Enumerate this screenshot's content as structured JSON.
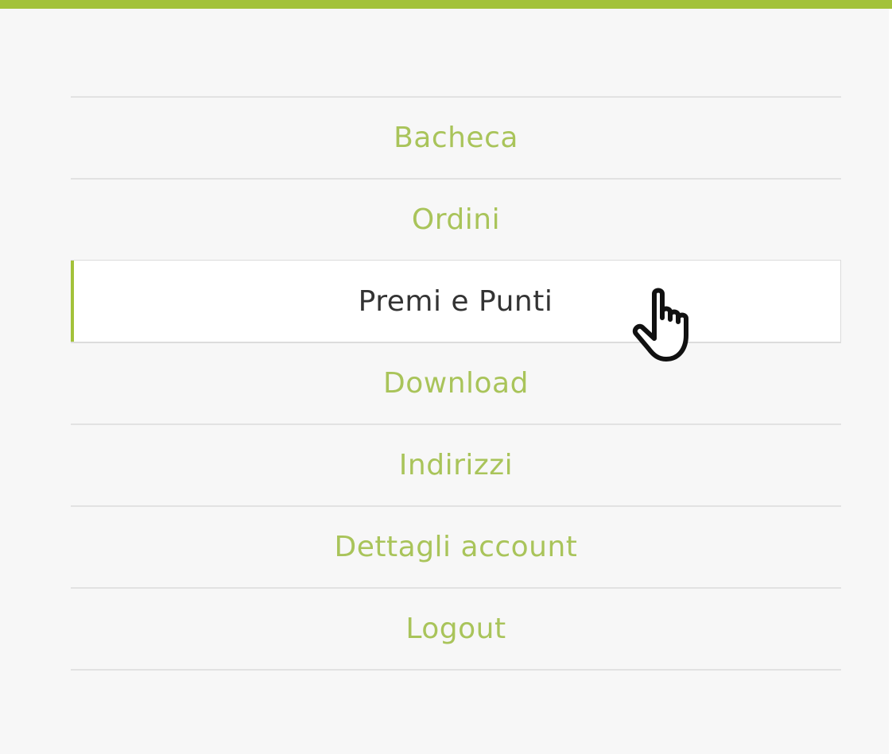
{
  "colors": {
    "accent": "#a3c23a",
    "link_text": "#a9c45a",
    "active_text": "#333333",
    "background": "#f7f7f7",
    "divider": "#e2e2e2"
  },
  "account_nav": {
    "items": [
      {
        "label": "Bacheca",
        "active": false
      },
      {
        "label": "Ordini",
        "active": false
      },
      {
        "label": "Premi e Punti",
        "active": true
      },
      {
        "label": "Download",
        "active": false
      },
      {
        "label": "Indirizzi",
        "active": false
      },
      {
        "label": "Dettagli account",
        "active": false
      },
      {
        "label": "Logout",
        "active": false
      }
    ]
  },
  "pointer": {
    "icon": "hand-pointer-icon"
  }
}
